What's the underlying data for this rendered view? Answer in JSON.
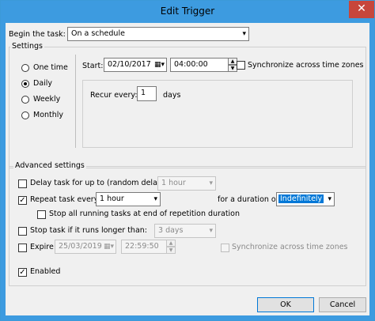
{
  "window": {
    "title": "Edit Trigger",
    "close_glyph": "✕"
  },
  "begin_task": {
    "label": "Begin the task:",
    "value": "On a schedule"
  },
  "settings": {
    "legend": "Settings",
    "radios": [
      {
        "label": "One time",
        "selected": false
      },
      {
        "label": "Daily",
        "selected": true
      },
      {
        "label": "Weekly",
        "selected": false
      },
      {
        "label": "Monthly",
        "selected": false
      }
    ],
    "start_label": "Start:",
    "start_date": "02/10/2017",
    "start_time": "04:00:00",
    "sync_label": "Synchronize across time zones",
    "recur_label": "Recur every:",
    "recur_value": "1",
    "recur_unit": "days"
  },
  "advanced": {
    "legend": "Advanced settings",
    "delay_label": "Delay task for up to (random delay):",
    "delay_value": "1 hour",
    "repeat_label": "Repeat task every:",
    "repeat_value": "1 hour",
    "duration_label": "for a duration of:",
    "duration_value": "Indefinitely",
    "stop_running_label": "Stop all running tasks at end of repetition duration",
    "stop_longer_label": "Stop task if it runs longer than:",
    "stop_longer_value": "3 days",
    "expire_label": "Expire:",
    "expire_date": "25/03/2019",
    "expire_time": "22:59:50",
    "expire_sync_label": "Synchronize across time zones",
    "enabled_label": "Enabled"
  },
  "buttons": {
    "ok": "OK",
    "cancel": "Cancel"
  },
  "icons": {
    "check": "✓",
    "dropdown": "▾",
    "spin_up": "▲",
    "spin_down": "▼",
    "calendar": "▦"
  }
}
